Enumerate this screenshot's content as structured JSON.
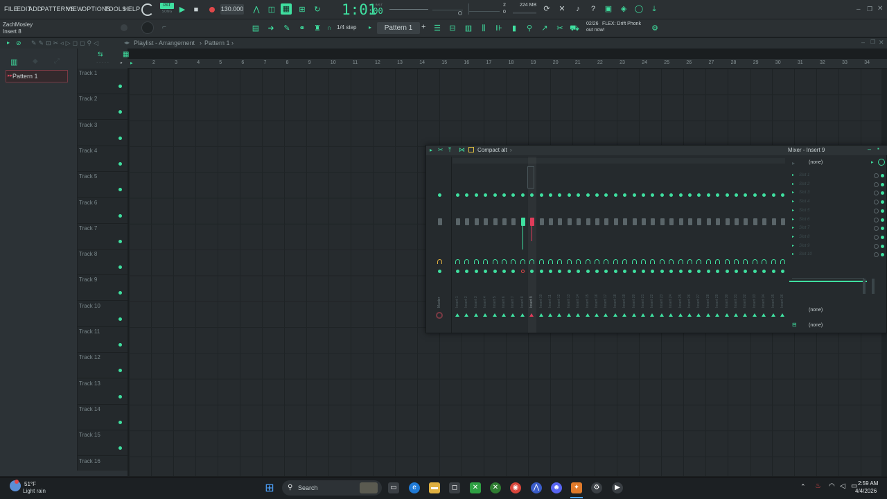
{
  "menu": {
    "items": [
      "FILE",
      "EDIT",
      "ADD",
      "PATTERNS",
      "VIEW",
      "OPTIONS",
      "TOOLS",
      "HELP"
    ],
    "user": "ZachMosley",
    "selected_insert": "Insert 8"
  },
  "transport": {
    "pat_label": "PAT",
    "song_label": "SONG",
    "tempo": "130.000",
    "time": "1:01",
    "time_sub": ":00",
    "time_unit": "B:S:T",
    "memory": "224 MB",
    "cpu_top": "2",
    "cpu_bottom": "0",
    "step": "1/4 step",
    "pattern": "Pattern 1",
    "news_count": "02/26",
    "news_text": "FLEX: Drift Phonk",
    "news_text2": "out now!"
  },
  "playlist": {
    "breadcrumb": "Playlist - Arrangement",
    "pattern": "Pattern 1",
    "picker_item": "Pattern 1",
    "tracks": [
      "Track 1",
      "Track 2",
      "Track 3",
      "Track 4",
      "Track 5",
      "Track 6",
      "Track 7",
      "Track 8",
      "Track 9",
      "Track 10",
      "Track 11",
      "Track 12",
      "Track 13",
      "Track 14",
      "Track 15",
      "Track 16"
    ],
    "ruler": [
      "2",
      "3",
      "4",
      "5",
      "6",
      "7",
      "8",
      "9",
      "10",
      "11",
      "12",
      "13",
      "14",
      "15",
      "16",
      "17",
      "18",
      "19",
      "20",
      "21",
      "22",
      "23",
      "24",
      "25",
      "26",
      "27",
      "28",
      "29",
      "30",
      "31",
      "32",
      "33",
      "34"
    ]
  },
  "mixer": {
    "layout": "Compact alt",
    "title": "Mixer - Insert 9",
    "preset": "(none)",
    "slots": [
      "Slot 1",
      "Slot 2",
      "Slot 3",
      "Slot 4",
      "Slot 5",
      "Slot 6",
      "Slot 7",
      "Slot 8",
      "Slot 9",
      "Slot 10"
    ],
    "eq_label": "(none)",
    "out_label": "(none)",
    "strip_labels": [
      "Master",
      "Insert 1",
      "Insert 2",
      "Insert 3",
      "Insert 4",
      "Insert 5",
      "Insert 6",
      "Insert 7",
      "Insert 8",
      "Insert 9",
      "Insert 10",
      "Insert 11",
      "Insert 12",
      "Insert 13",
      "Insert 14",
      "Insert 15",
      "Insert 16",
      "Insert 17",
      "Insert 18",
      "Insert 19",
      "Insert 20",
      "Insert 21",
      "Insert 22",
      "Insert 23",
      "Insert 24",
      "Insert 25",
      "Insert 26",
      "Insert 27",
      "Insert 28",
      "Insert 29",
      "Insert 30",
      "Insert 31",
      "Insert 32",
      "Insert 33",
      "Insert 34",
      "Insert 35",
      "Insert 36"
    ]
  },
  "taskbar": {
    "weather_temp": "51°F",
    "weather_text": "Light rain",
    "search": "Search",
    "time": "2:59 AM",
    "date": "4/4/2026"
  },
  "colors": {
    "accent": "#3fe0a0",
    "record": "#e0484a",
    "selected_insert": "#e03c5a"
  }
}
